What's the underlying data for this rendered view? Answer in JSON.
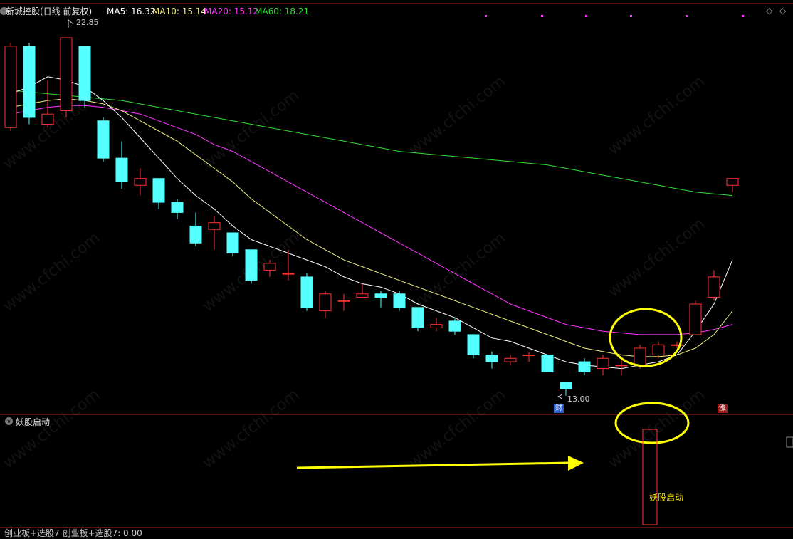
{
  "header": {
    "stock_title": "新城控股(日线 前复权)",
    "ma5": "MA5: 16.32",
    "ma10": "MA10: 15.14",
    "ma20": "MA20: 15.12",
    "ma60": "MA60: 18.21"
  },
  "colors": {
    "up": "#ff3232",
    "down": "#54ffff",
    "ma5": "#ffffff",
    "ma10": "#f0f080",
    "ma20": "#ff33ff",
    "ma60": "#33dd33",
    "divider": "#b02020",
    "signal": "#ffff00"
  },
  "chart_data": {
    "type": "candlestick",
    "high_label": "22.85",
    "low_label": "13.00",
    "candles": [
      {
        "o": 20.2,
        "c": 22.6,
        "h": 22.7,
        "l": 20.1
      },
      {
        "o": 22.6,
        "c": 20.5,
        "h": 22.7,
        "l": 20.3
      },
      {
        "o": 20.3,
        "c": 20.6,
        "h": 21.6,
        "l": 20.2
      },
      {
        "o": 20.7,
        "c": 22.85,
        "h": 22.85,
        "l": 20.5
      },
      {
        "o": 22.6,
        "c": 21.0,
        "h": 22.6,
        "l": 20.8
      },
      {
        "o": 20.4,
        "c": 19.3,
        "h": 20.5,
        "l": 19.2
      },
      {
        "o": 19.3,
        "c": 18.6,
        "h": 19.8,
        "l": 18.4
      },
      {
        "o": 18.5,
        "c": 18.7,
        "h": 19.0,
        "l": 18.2
      },
      {
        "o": 18.7,
        "c": 18.0,
        "h": 18.7,
        "l": 17.8
      },
      {
        "o": 18.0,
        "c": 17.7,
        "h": 18.1,
        "l": 17.5
      },
      {
        "o": 17.3,
        "c": 16.8,
        "h": 17.7,
        "l": 16.7
      },
      {
        "o": 17.2,
        "c": 17.4,
        "h": 17.6,
        "l": 16.6
      },
      {
        "o": 17.1,
        "c": 16.5,
        "h": 17.1,
        "l": 16.4
      },
      {
        "o": 16.6,
        "c": 15.7,
        "h": 16.6,
        "l": 15.6
      },
      {
        "o": 16.0,
        "c": 16.2,
        "h": 16.3,
        "l": 15.8
      },
      {
        "o": 15.9,
        "c": 15.9,
        "h": 16.6,
        "l": 15.7
      },
      {
        "o": 15.8,
        "c": 14.9,
        "h": 15.9,
        "l": 14.8
      },
      {
        "o": 14.8,
        "c": 15.3,
        "h": 15.4,
        "l": 14.6
      },
      {
        "o": 15.1,
        "c": 15.1,
        "h": 15.3,
        "l": 14.8
      },
      {
        "o": 15.2,
        "c": 15.3,
        "h": 15.6,
        "l": 15.2
      },
      {
        "o": 15.3,
        "c": 15.2,
        "h": 15.4,
        "l": 14.9
      },
      {
        "o": 15.3,
        "c": 14.9,
        "h": 15.4,
        "l": 14.8
      },
      {
        "o": 14.9,
        "c": 14.3,
        "h": 14.9,
        "l": 14.2
      },
      {
        "o": 14.3,
        "c": 14.4,
        "h": 14.6,
        "l": 14.2
      },
      {
        "o": 14.5,
        "c": 14.2,
        "h": 14.6,
        "l": 14.1
      },
      {
        "o": 14.1,
        "c": 13.5,
        "h": 14.1,
        "l": 13.4
      },
      {
        "o": 13.5,
        "c": 13.3,
        "h": 13.6,
        "l": 13.1
      },
      {
        "o": 13.3,
        "c": 13.4,
        "h": 13.5,
        "l": 13.2
      },
      {
        "o": 13.5,
        "c": 13.5,
        "h": 13.6,
        "l": 13.3
      },
      {
        "o": 13.5,
        "c": 13.0,
        "h": 13.5,
        "l": 13.0
      },
      {
        "o": 12.7,
        "c": 12.5,
        "h": 12.7,
        "l": 12.3
      },
      {
        "o": 13.3,
        "c": 13.0,
        "h": 13.4,
        "l": 12.9
      },
      {
        "o": 13.1,
        "c": 13.4,
        "h": 13.5,
        "l": 12.9
      },
      {
        "o": 13.2,
        "c": 13.2,
        "h": 13.4,
        "l": 12.9
      },
      {
        "o": 13.2,
        "c": 13.7,
        "h": 13.8,
        "l": 13.1
      },
      {
        "o": 13.5,
        "c": 13.8,
        "h": 13.9,
        "l": 13.4
      },
      {
        "o": 13.8,
        "c": 13.8,
        "h": 13.9,
        "l": 13.7
      },
      {
        "o": 14.1,
        "c": 15.0,
        "h": 15.1,
        "l": 14.1
      },
      {
        "o": 15.2,
        "c": 15.8,
        "h": 16.0,
        "l": 15.1
      },
      {
        "o": 18.5,
        "c": 18.7,
        "h": 18.7,
        "l": 18.3
      }
    ],
    "ma5": [
      21.2,
      21.4,
      21.7,
      21.6,
      21.4,
      21.0,
      20.5,
      19.9,
      19.3,
      18.7,
      18.2,
      17.8,
      17.3,
      16.9,
      16.7,
      16.5,
      16.3,
      16.1,
      15.8,
      15.6,
      15.5,
      15.3,
      15.0,
      14.8,
      14.6,
      14.3,
      14.0,
      13.9,
      13.7,
      13.5,
      13.3,
      13.2,
      13.15,
      13.1,
      13.2,
      13.3,
      13.5,
      14.2,
      15.0,
      16.3
    ],
    "ma10": [
      20.8,
      20.9,
      21.0,
      21.05,
      21.0,
      20.9,
      20.7,
      20.4,
      20.1,
      19.8,
      19.4,
      19.0,
      18.6,
      18.1,
      17.7,
      17.3,
      16.9,
      16.6,
      16.3,
      16.1,
      15.9,
      15.7,
      15.5,
      15.3,
      15.1,
      14.9,
      14.7,
      14.5,
      14.3,
      14.1,
      13.9,
      13.7,
      13.6,
      13.5,
      13.45,
      13.45,
      13.5,
      13.7,
      14.1,
      14.8
    ],
    "ma20": [
      20.6,
      20.7,
      20.8,
      20.85,
      20.85,
      20.8,
      20.7,
      20.6,
      20.4,
      20.2,
      20.0,
      19.7,
      19.5,
      19.2,
      18.9,
      18.6,
      18.3,
      18.0,
      17.7,
      17.4,
      17.1,
      16.8,
      16.5,
      16.2,
      15.9,
      15.6,
      15.3,
      15.0,
      14.8,
      14.6,
      14.4,
      14.3,
      14.2,
      14.15,
      14.1,
      14.1,
      14.1,
      14.15,
      14.25,
      14.4
    ],
    "ma60": [
      21.3,
      21.25,
      21.2,
      21.15,
      21.1,
      21.05,
      21.0,
      20.9,
      20.8,
      20.7,
      20.6,
      20.5,
      20.4,
      20.3,
      20.2,
      20.1,
      20.0,
      19.9,
      19.8,
      19.7,
      19.6,
      19.5,
      19.45,
      19.4,
      19.35,
      19.3,
      19.25,
      19.2,
      19.15,
      19.1,
      19.0,
      18.9,
      18.8,
      18.7,
      18.6,
      18.5,
      18.4,
      18.3,
      18.25,
      18.2
    ],
    "ylim": [
      12.0,
      23.5
    ]
  },
  "markers": {
    "cai_label": "财",
    "zhang_label": "涨"
  },
  "indicator": {
    "panel_title": "妖股启动",
    "signal_label": "妖股启动"
  },
  "footer": {
    "text": "创业板+选股7  创业板+选股7: 0.00"
  },
  "watermark": "www.cfchi.com"
}
